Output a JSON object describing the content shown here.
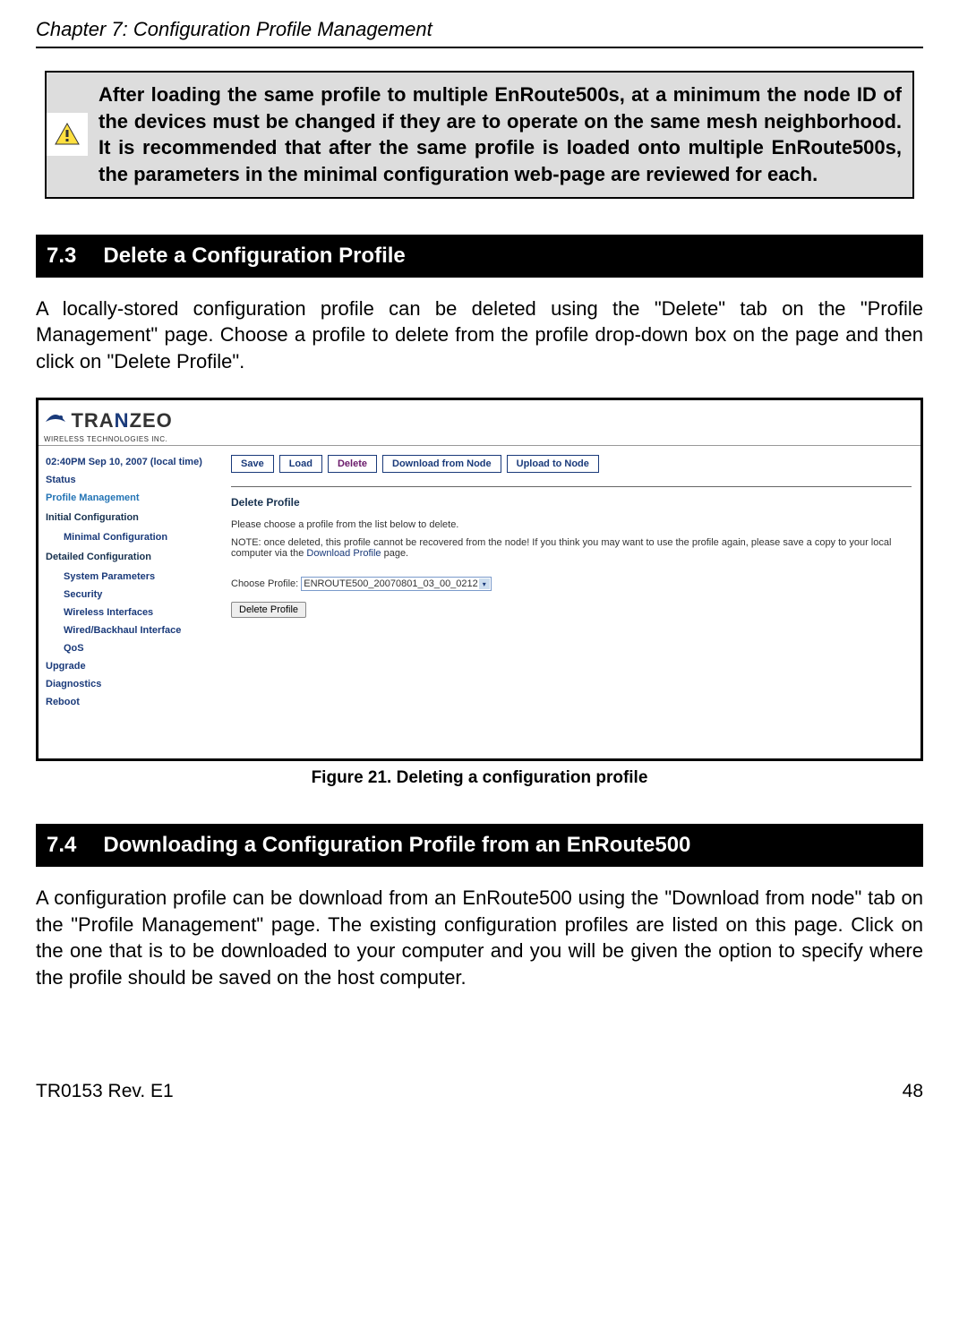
{
  "chapter_header": "Chapter 7: Configuration Profile Management",
  "warning": {
    "text": "After loading the same profile to multiple EnRoute500s, at a minimum the node ID of the devices must be changed if they are to operate on the same mesh neighborhood. It is recommended that after the same profile is loaded onto multiple EnRoute500s, the parameters in the minimal configuration web-page are reviewed for each."
  },
  "section73": {
    "number": "7.3",
    "title": "Delete a Configuration Profile",
    "body": "A locally-stored configuration profile can be deleted using the \"Delete\" tab on the \"Profile Management\" page. Choose a profile to delete from the profile drop-down box on the page and then click on \"Delete Profile\"."
  },
  "screenshot": {
    "logo_main": "TRANZEO",
    "logo_sub": "WIRELESS TECHNOLOGIES INC.",
    "time": "02:40PM Sep 10, 2007 (local time)",
    "sidebar": {
      "status": "Status",
      "profile_mgmt": "Profile Management",
      "initial_config": "Initial Configuration",
      "minimal_config": "Minimal Configuration",
      "detailed_config": "Detailed Configuration",
      "system_params": "System Parameters",
      "security": "Security",
      "wireless": "Wireless Interfaces",
      "wired": "Wired/Backhaul Interface",
      "qos": "QoS",
      "upgrade": "Upgrade",
      "diagnostics": "Diagnostics",
      "reboot": "Reboot"
    },
    "tabs": {
      "save": "Save",
      "load": "Load",
      "delete": "Delete",
      "download": "Download from Node",
      "upload": "Upload to Node"
    },
    "pane": {
      "title": "Delete Profile",
      "text1": "Please choose a profile from the list below to delete.",
      "text2_a": "NOTE: once deleted, this profile cannot be recovered from the node! If you think you may want to use the profile again, please save a copy to your local computer via the ",
      "text2_link": "Download Profile",
      "text2_b": " page.",
      "choose_label": "Choose Profile:",
      "selected_profile": "ENROUTE500_20070801_03_00_0212",
      "delete_button": "Delete Profile"
    }
  },
  "figure_caption": "Figure 21. Deleting a configuration profile",
  "section74": {
    "number": "7.4",
    "title": "Downloading a Configuration Profile from an EnRoute500",
    "body": "A configuration profile can be download from an EnRoute500 using the \"Download from node\" tab on the \"Profile Management\" page. The existing configuration profiles are listed on this page. Click on the one that is to be downloaded to your computer and you will be given the option to specify where the profile should be saved on the host computer."
  },
  "footer": {
    "left": "TR0153 Rev. E1",
    "right": "48"
  }
}
